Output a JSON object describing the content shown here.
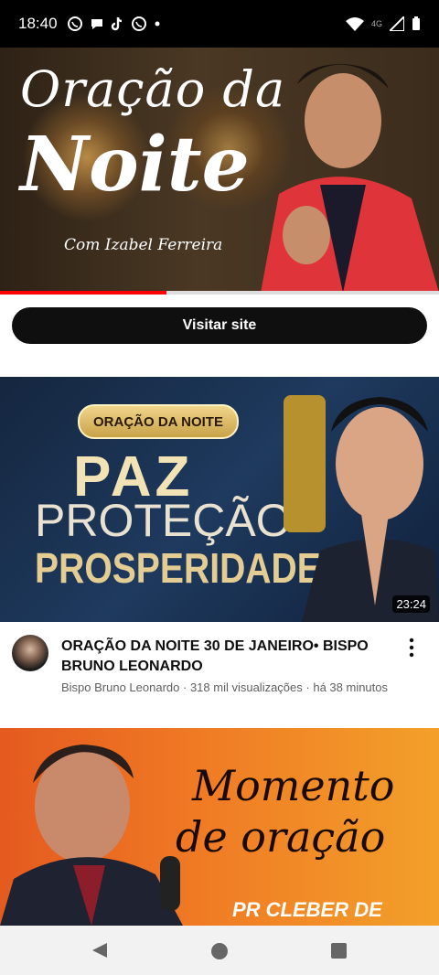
{
  "status_bar": {
    "time": "18:40",
    "network": "4G"
  },
  "ad": {
    "title_line1": "Oração da",
    "title_line2": "Noite",
    "subtitle": "Com Izabel Ferreira",
    "progress": 0.38,
    "button_label": "Visitar site"
  },
  "video1": {
    "badge": "ORAÇÃO DA NOITE",
    "headline1": "PAZ",
    "headline2": "PROTEÇÃO",
    "headline3": "PROSPERIDADE",
    "duration": "23:24",
    "title": "ORAÇÃO DA NOITE 30 DE JANEIRO• BISPO BRUNO LEONARDO",
    "channel": "Bispo Bruno Leonardo",
    "views": "318 mil visualizações",
    "age": "há 38 minutos",
    "meta_sep": " · "
  },
  "video2": {
    "line1": "Momento",
    "line2": "de oração",
    "caption": "PR CLEBER DE"
  },
  "colors": {
    "progress": "#ff0000",
    "button_bg": "#0f0f0f"
  }
}
